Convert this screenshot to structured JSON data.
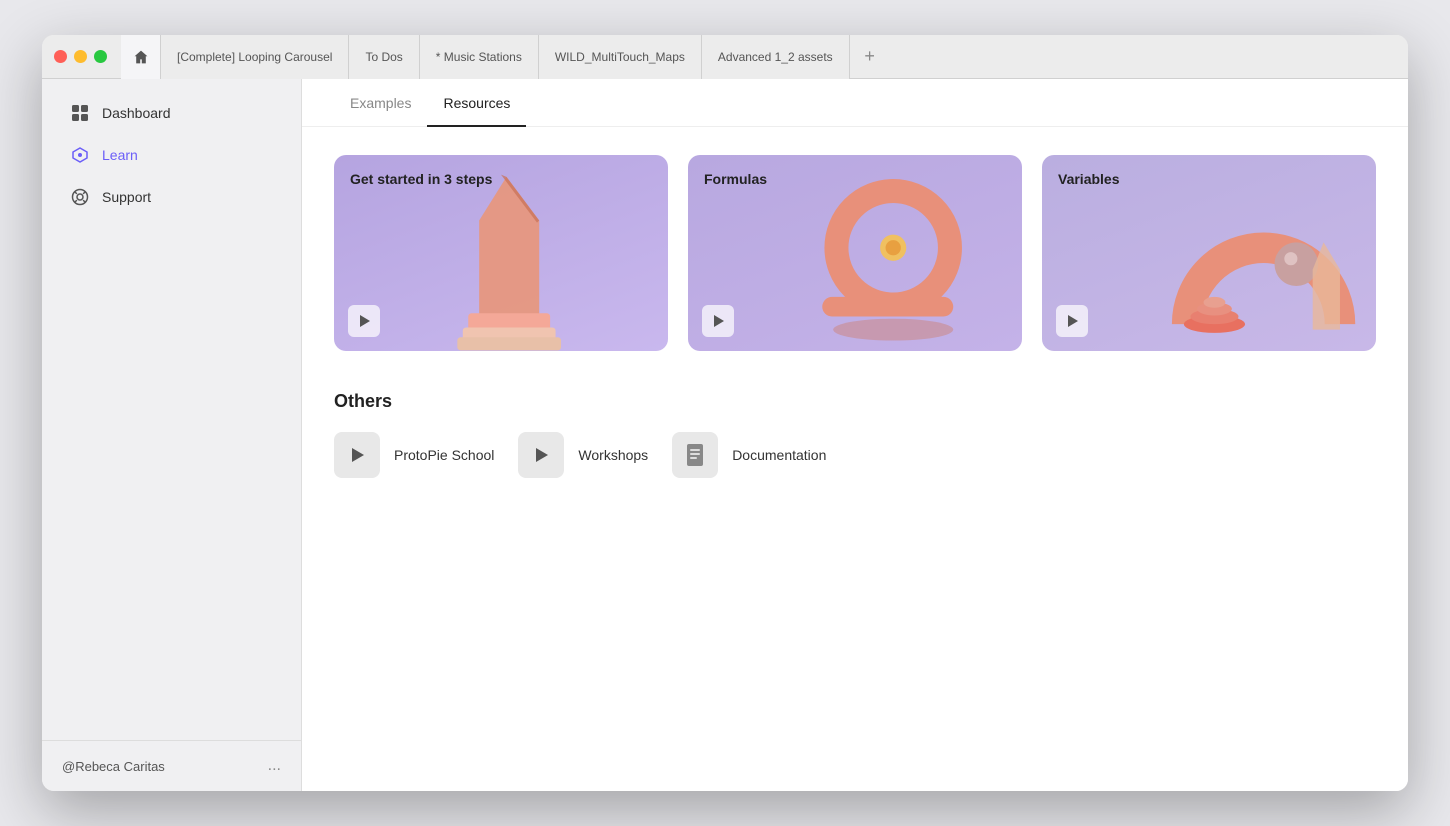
{
  "titlebar": {
    "tabs": [
      {
        "id": "complete-looping",
        "label": "[Complete] Looping Carousel"
      },
      {
        "id": "to-dos",
        "label": "To Dos"
      },
      {
        "id": "music-stations",
        "label": "* Music Stations"
      },
      {
        "id": "wild-multitouch",
        "label": "WILD_MultiTouch_Maps"
      },
      {
        "id": "advanced-assets",
        "label": "Advanced 1_2 assets"
      }
    ],
    "add_tab_label": "+"
  },
  "sidebar": {
    "nav_items": [
      {
        "id": "dashboard",
        "label": "Dashboard",
        "icon": "grid-icon",
        "active": false
      },
      {
        "id": "learn",
        "label": "Learn",
        "icon": "learn-icon",
        "active": true
      },
      {
        "id": "support",
        "label": "Support",
        "icon": "support-icon",
        "active": false
      }
    ],
    "user": {
      "name": "@Rebeca Caritas",
      "more": "..."
    }
  },
  "content": {
    "tabs": [
      {
        "id": "examples",
        "label": "Examples",
        "active": false
      },
      {
        "id": "resources",
        "label": "Resources",
        "active": true
      }
    ],
    "cards": [
      {
        "id": "get-started",
        "label": "Get started in 3 steps",
        "play": true
      },
      {
        "id": "formulas",
        "label": "Formulas",
        "play": true
      },
      {
        "id": "variables",
        "label": "Variables",
        "play": true
      }
    ],
    "others_title": "Others",
    "others": [
      {
        "id": "protopie-school",
        "label": "ProtoPie School",
        "icon": "play-icon"
      },
      {
        "id": "workshops",
        "label": "Workshops",
        "icon": "play-icon"
      },
      {
        "id": "documentation",
        "label": "Documentation",
        "icon": "doc-icon"
      }
    ]
  }
}
